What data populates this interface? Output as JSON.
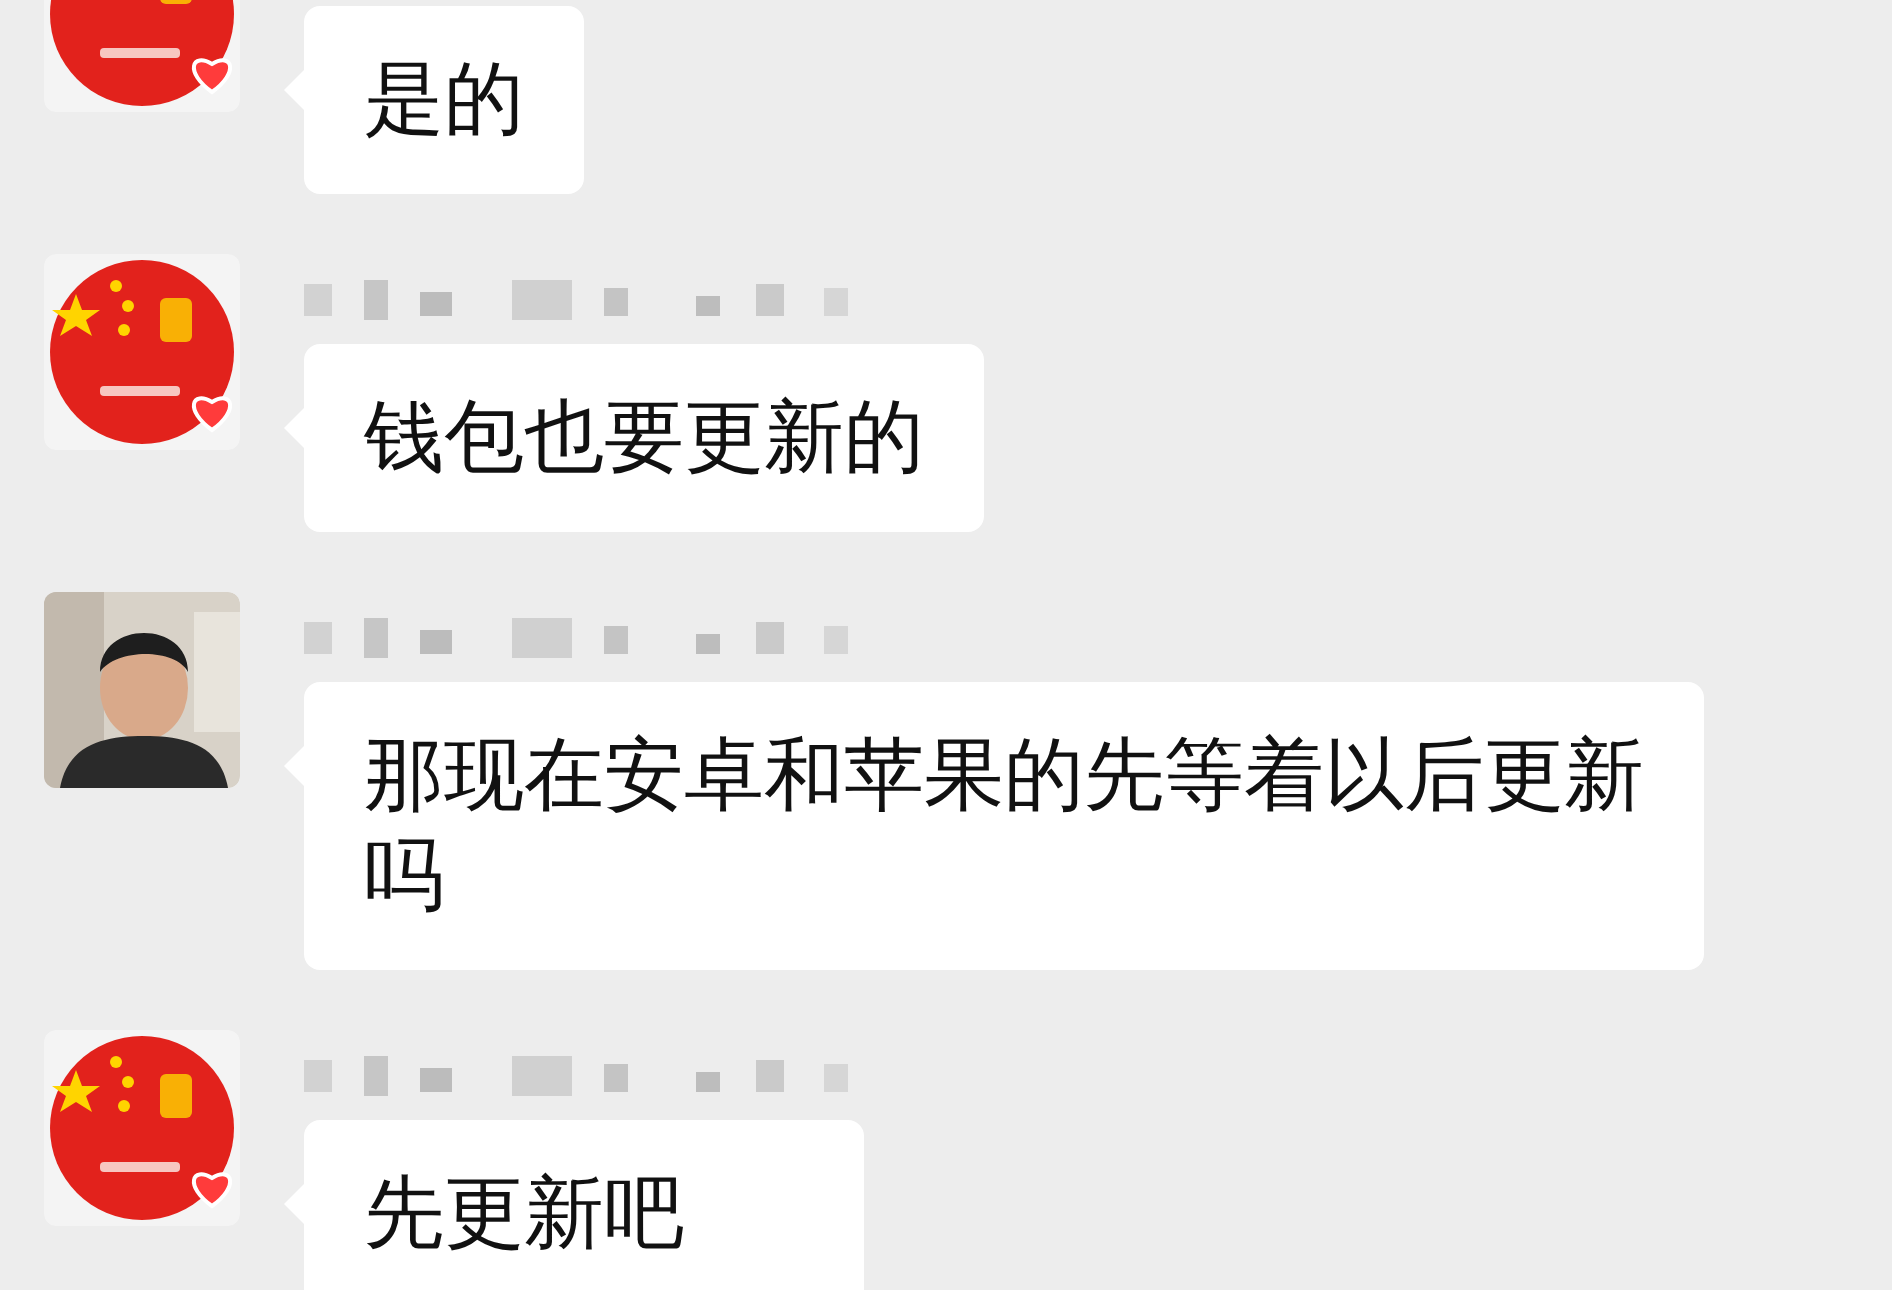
{
  "messages": [
    {
      "kind": "flag",
      "sender_name_hidden": false,
      "text": "是的"
    },
    {
      "kind": "flag",
      "sender_name_hidden": true,
      "text": "钱包也要更新的"
    },
    {
      "sender_name_hidden": true,
      "text": "那现在安卓和苹果的先等着以后更新吗"
    },
    {
      "kind": "flag",
      "sender_name_hidden": true,
      "text": "先更新吧"
    }
  ]
}
